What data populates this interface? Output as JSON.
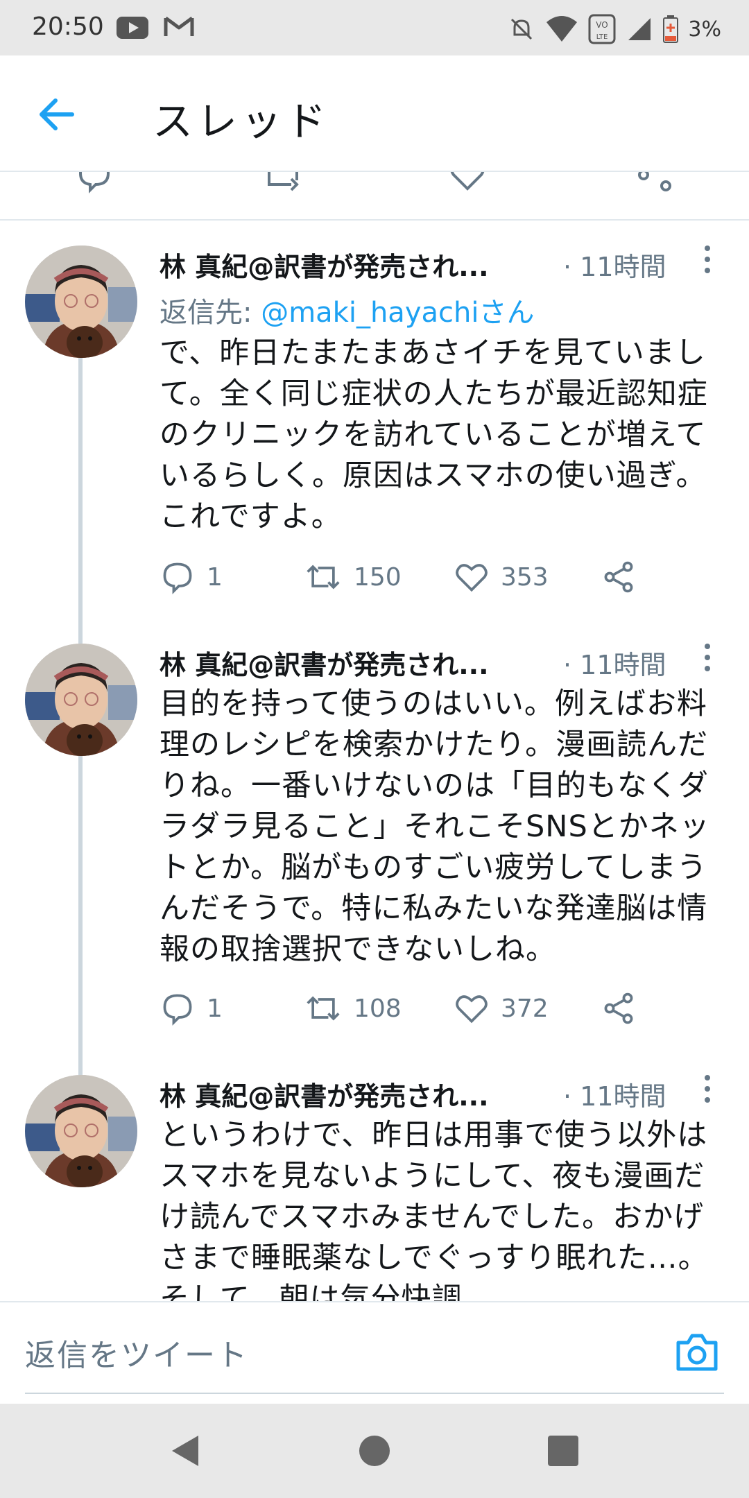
{
  "status_bar": {
    "time": "20:50",
    "battery": "3%",
    "icons": [
      "youtube-icon",
      "gmail-icon",
      "mute-icon",
      "wifi-icon",
      "volte-icon",
      "signal-icon",
      "battery-icon"
    ]
  },
  "header": {
    "title": "スレッド",
    "back_icon": "back-arrow-icon"
  },
  "colors": {
    "accent": "#1da1f2",
    "secondary_text": "#657786",
    "thread_line": "#ccd6dd",
    "divider": "#e1e8ed"
  },
  "tweets": [
    {
      "name": "林 真紀@訳書が発売され...",
      "time": "· 11時間",
      "reply_prefix": "返信先: ",
      "reply_to": "@maki_hayachiさん",
      "lines": [
        "で、昨日たまたまあさイチを見ていまし",
        "て。全く同じ症状の人たちが最近認知症",
        "のクリニックを訪れていることが増えて",
        "いるらしく。原因はスマホの使い過ぎ。",
        "これですよ。"
      ],
      "replies": "1",
      "retweets": "150",
      "likes": "353"
    },
    {
      "name": "林 真紀@訳書が発売され...",
      "time": "· 11時間",
      "lines": [
        "目的を持って使うのはいい。例えばお料",
        "理のレシピを検索かけたり。漫画読んだ",
        "りね。一番いけないのは「目的もなくダ",
        "ラダラ見ること」それこそSNSとかネッ",
        "トとか。脳がものすごい疲労してしまう",
        "んだそうで。特に私みたいな発達脳は情",
        "報の取捨選択できないしね。"
      ],
      "replies": "1",
      "retweets": "108",
      "likes": "372"
    },
    {
      "name": "林 真紀@訳書が発売され...",
      "time": "· 11時間",
      "lines": [
        "というわけで、昨日は用事で使う以外は",
        "スマホを見ないようにして、夜も漫画だ",
        "け読んでスマホみませんでした。おかげ",
        "さまで睡眠薬なしでぐっすり眠れた…。",
        "そして、朝は気分快調。"
      ]
    }
  ],
  "reply_bar": {
    "placeholder": "返信をツイート",
    "camera_icon": "camera-icon"
  },
  "nav_bar": {
    "buttons": [
      "back-triangle-icon",
      "home-circle-icon",
      "recents-square-icon"
    ]
  }
}
